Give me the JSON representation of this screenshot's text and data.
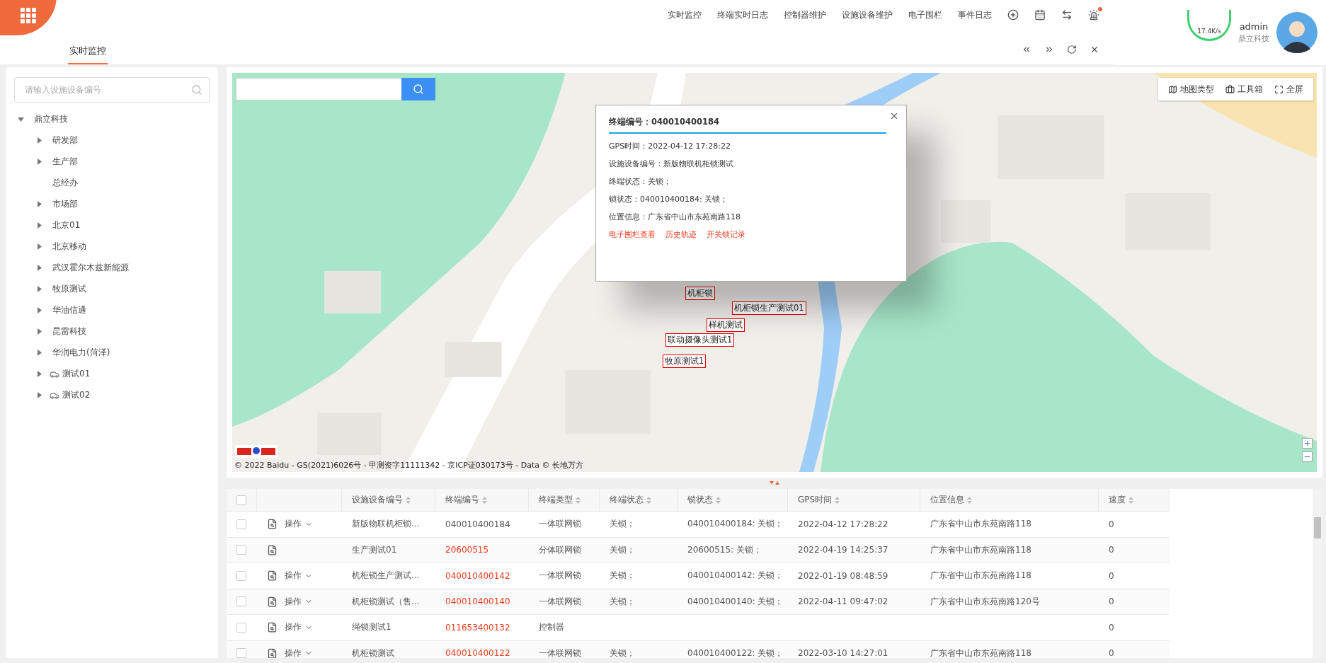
{
  "header": {
    "nav": [
      "实时监控",
      "终端实时日志",
      "控制器维护",
      "设施设备维护",
      "电子围栏",
      "事件日志"
    ],
    "alert_dot": true,
    "speed": "17.4K/s",
    "user": "admin",
    "company": "鼎立科技"
  },
  "tabs": [
    {
      "label": "实时监控",
      "selected": true
    }
  ],
  "sidebar": {
    "search_placeholder": "请输入设施设备编号",
    "tree": [
      {
        "label": "鼎立科技",
        "kind": "group",
        "expanded": true,
        "children": [
          {
            "label": "研发部",
            "kind": "group",
            "expanded": false
          },
          {
            "label": "生产部",
            "kind": "group",
            "expanded": false
          },
          {
            "label": "总经办",
            "kind": "leaf"
          },
          {
            "label": "市场部",
            "kind": "group",
            "expanded": false
          },
          {
            "label": "北京01",
            "kind": "group",
            "expanded": false
          },
          {
            "label": "北京移动",
            "kind": "group",
            "expanded": false
          },
          {
            "label": "武汉霍尔木兹新能源",
            "kind": "group",
            "expanded": false
          },
          {
            "label": "牧原测试",
            "kind": "group",
            "expanded": false
          },
          {
            "label": "华油信通",
            "kind": "group",
            "expanded": false
          },
          {
            "label": "昆雷科技",
            "kind": "group",
            "expanded": false
          },
          {
            "label": "华润电力(菏泽)",
            "kind": "group",
            "expanded": false
          },
          {
            "label": "测试01",
            "kind": "vehicle",
            "expanded": false
          },
          {
            "label": "测试02",
            "kind": "vehicle",
            "expanded": false
          }
        ]
      }
    ]
  },
  "map": {
    "tools": [
      "地图类型",
      "工具箱",
      "全屏"
    ],
    "popup": {
      "title": "终端编号：040010400184",
      "lines": [
        "GPS时间：2022-04-12 17:28:22",
        "设施设备编号：新版物联机柜锁测试",
        "终端状态：关锁；",
        "锁状态：040010400184: 关锁；",
        "位置信息：广东省中山市东苑南路118"
      ],
      "links": [
        "电子围栏查看",
        "历史轨迹",
        "开关锁记录"
      ]
    },
    "markers": [
      {
        "label": "机柜锁"
      },
      {
        "label": "机柜锁生产测试01"
      },
      {
        "label": "样机测试"
      },
      {
        "label": "联动摄像头测试1"
      },
      {
        "label": "牧原测试1"
      }
    ],
    "copyright": "© 2022 Baidu - GS(2021)6026号 - 甲测资字11111342 - 京ICP证030173号 - Data © 长地万方"
  },
  "table": {
    "select_all": false,
    "columns": [
      "设施设备编号",
      "终端编号",
      "终端类型",
      "终端状态",
      "锁状态",
      "GPS时间",
      "位置信息",
      "速度"
    ],
    "rows": [
      {
        "checked": false,
        "ops": "操作",
        "alert": false,
        "cells": [
          "新版物联机柜锁...",
          "040010400184",
          "一体联网锁",
          "关锁；",
          "040010400184: 关锁；",
          "2022-04-12 17:28:22",
          "广东省中山市东苑南路118",
          "0"
        ]
      },
      {
        "checked": false,
        "alert": true,
        "cells": [
          "生产测试01",
          "20600515",
          "分体联网锁",
          "关锁；",
          "20600515: 关锁；",
          "2022-04-19 14:25:37",
          "广东省中山市东苑南路118",
          "0"
        ]
      },
      {
        "checked": false,
        "ops": "操作",
        "alert": true,
        "cells": [
          "机柜锁生产测试...",
          "040010400142",
          "一体联网锁",
          "关锁；",
          "040010400142: 关锁；",
          "2022-01-19 08:48:59",
          "广东省中山市东苑南路118",
          "0"
        ]
      },
      {
        "checked": false,
        "ops": "操作",
        "alert": true,
        "cells": [
          "机柜锁测试（售...",
          "040010400140",
          "一体联网锁",
          "关锁；",
          "040010400140: 关锁；",
          "2022-04-11 09:47:02",
          "广东省中山市东苑南路120号",
          "0"
        ]
      },
      {
        "checked": false,
        "ops": "操作",
        "alert": true,
        "cells": [
          "绳锁测试1",
          "011653400132",
          "控制器",
          "",
          "",
          "",
          "",
          "0"
        ]
      },
      {
        "checked": false,
        "ops": "操作",
        "alert": true,
        "cells": [
          "机柜锁测试",
          "040010400122",
          "一体联网锁",
          "关锁；",
          "040010400122: 关锁；",
          "2022-03-10 14:27:01",
          "广东省中山市东苑南路118",
          "0"
        ]
      }
    ]
  }
}
